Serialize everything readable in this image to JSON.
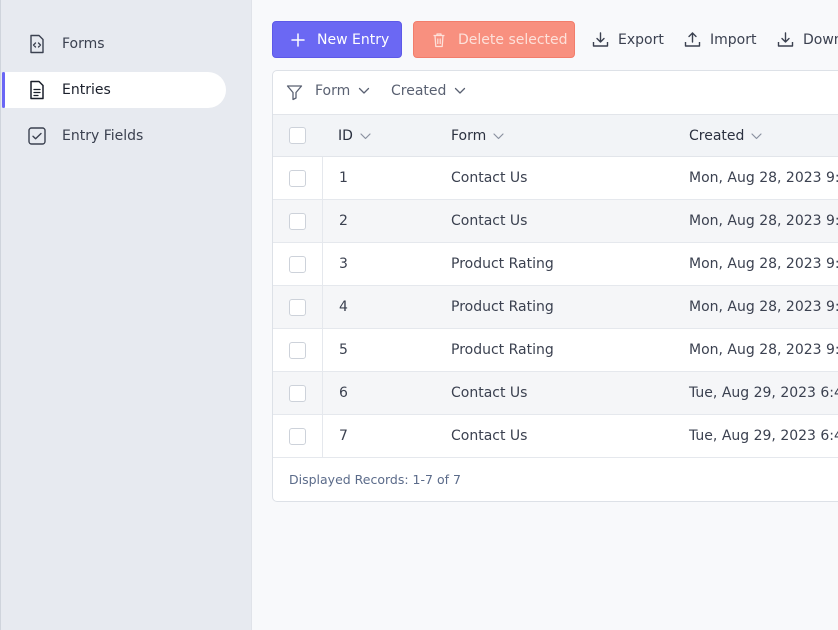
{
  "sidebar": {
    "items": [
      {
        "label": "Forms",
        "icon": "code-file-icon",
        "active": false
      },
      {
        "label": "Entries",
        "icon": "document-icon",
        "active": true
      },
      {
        "label": "Entry Fields",
        "icon": "checkbox-icon",
        "active": false
      }
    ]
  },
  "toolbar": {
    "new_entry": "New Entry",
    "delete_selected": "Delete selected",
    "export": "Export",
    "import": "Import",
    "download": "Down"
  },
  "filters": {
    "form": "Form",
    "created": "Created"
  },
  "table": {
    "columns": [
      "ID",
      "Form",
      "Created"
    ],
    "rows": [
      {
        "id": "1",
        "form": "Contact Us",
        "created": "Mon, Aug 28, 2023 9:("
      },
      {
        "id": "2",
        "form": "Contact Us",
        "created": "Mon, Aug 28, 2023 9:("
      },
      {
        "id": "3",
        "form": "Product Rating",
        "created": "Mon, Aug 28, 2023 9:("
      },
      {
        "id": "4",
        "form": "Product Rating",
        "created": "Mon, Aug 28, 2023 9:("
      },
      {
        "id": "5",
        "form": "Product Rating",
        "created": "Mon, Aug 28, 2023 9:1"
      },
      {
        "id": "6",
        "form": "Contact Us",
        "created": "Tue, Aug 29, 2023 6:4"
      },
      {
        "id": "7",
        "form": "Contact Us",
        "created": "Tue, Aug 29, 2023 6:4"
      }
    ]
  },
  "footer": {
    "records": "Displayed Records: 1-7 of 7"
  },
  "colors": {
    "accent": "#6b68f3",
    "danger": "#f8907f",
    "sidebar_bg": "#e7eaf0"
  }
}
